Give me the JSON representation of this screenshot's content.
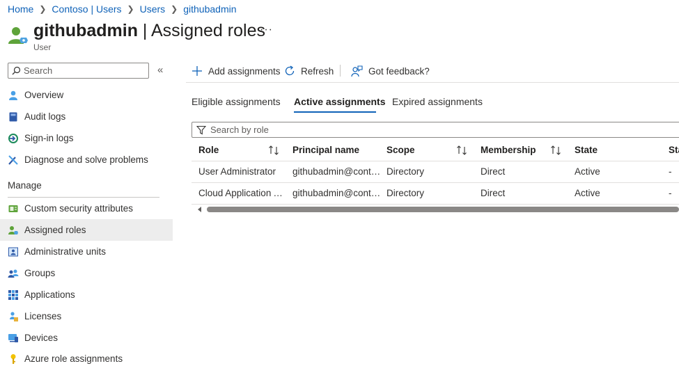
{
  "breadcrumb": [
    {
      "label": "Home"
    },
    {
      "label": "Contoso | Users"
    },
    {
      "label": "Users"
    },
    {
      "label": "githubadmin"
    }
  ],
  "header": {
    "title_bold": "githubadmin",
    "title_rest": " | Assigned roles",
    "more": "···",
    "subtitle": "User"
  },
  "sidebar": {
    "search_placeholder": "Search",
    "collapse": "«",
    "items": [
      {
        "label": "Overview",
        "icon": "person-icon"
      },
      {
        "label": "Audit logs",
        "icon": "book-icon"
      },
      {
        "label": "Sign-in logs",
        "icon": "sign-in-icon"
      },
      {
        "label": "Diagnose and solve problems",
        "icon": "wrench-icon"
      }
    ],
    "section_label": "Manage",
    "manage_items": [
      {
        "label": "Custom security attributes",
        "icon": "attributes-icon"
      },
      {
        "label": "Assigned roles",
        "icon": "assigned-roles-icon",
        "selected": true
      },
      {
        "label": "Administrative units",
        "icon": "admin-units-icon"
      },
      {
        "label": "Groups",
        "icon": "groups-icon"
      },
      {
        "label": "Applications",
        "icon": "apps-grid-icon"
      },
      {
        "label": "Licenses",
        "icon": "license-icon"
      },
      {
        "label": "Devices",
        "icon": "device-icon"
      },
      {
        "label": "Azure role assignments",
        "icon": "key-icon"
      }
    ]
  },
  "toolbar": {
    "add_label": "Add assignments",
    "refresh_label": "Refresh",
    "feedback_label": "Got feedback?"
  },
  "tabs": [
    {
      "label": "Eligible assignments"
    },
    {
      "label": "Active assignments",
      "active": true
    },
    {
      "label": "Expired assignments"
    }
  ],
  "filter": {
    "placeholder": "Search by role"
  },
  "table": {
    "columns": [
      "Role",
      "Principal name",
      "Scope",
      "Membership",
      "State",
      "Sta"
    ],
    "rows": [
      [
        "User Administrator",
        "githubadmin@conto...",
        "Directory",
        "Direct",
        "Active",
        "-"
      ],
      [
        "Cloud Application A...",
        "githubadmin@conto...",
        "Directory",
        "Direct",
        "Active",
        "-"
      ]
    ]
  },
  "colors": {
    "accent": "#0f62b8",
    "selected_bg": "#ededed",
    "text": "#323130"
  }
}
